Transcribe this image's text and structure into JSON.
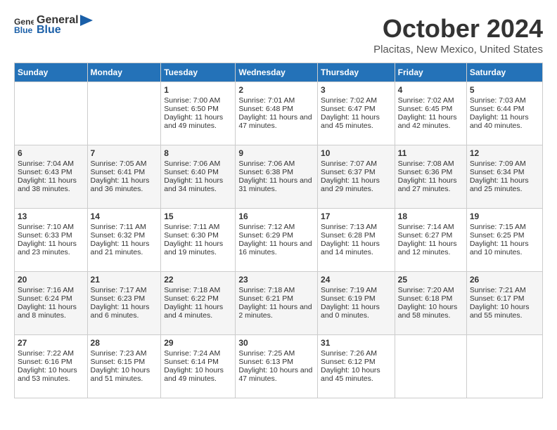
{
  "header": {
    "logo_line1": "General",
    "logo_line2": "Blue",
    "month_title": "October 2024",
    "location": "Placitas, New Mexico, United States"
  },
  "weekdays": [
    "Sunday",
    "Monday",
    "Tuesday",
    "Wednesday",
    "Thursday",
    "Friday",
    "Saturday"
  ],
  "weeks": [
    [
      {
        "day": "",
        "sunrise": "",
        "sunset": "",
        "daylight": ""
      },
      {
        "day": "",
        "sunrise": "",
        "sunset": "",
        "daylight": ""
      },
      {
        "day": "1",
        "sunrise": "Sunrise: 7:00 AM",
        "sunset": "Sunset: 6:50 PM",
        "daylight": "Daylight: 11 hours and 49 minutes."
      },
      {
        "day": "2",
        "sunrise": "Sunrise: 7:01 AM",
        "sunset": "Sunset: 6:48 PM",
        "daylight": "Daylight: 11 hours and 47 minutes."
      },
      {
        "day": "3",
        "sunrise": "Sunrise: 7:02 AM",
        "sunset": "Sunset: 6:47 PM",
        "daylight": "Daylight: 11 hours and 45 minutes."
      },
      {
        "day": "4",
        "sunrise": "Sunrise: 7:02 AM",
        "sunset": "Sunset: 6:45 PM",
        "daylight": "Daylight: 11 hours and 42 minutes."
      },
      {
        "day": "5",
        "sunrise": "Sunrise: 7:03 AM",
        "sunset": "Sunset: 6:44 PM",
        "daylight": "Daylight: 11 hours and 40 minutes."
      }
    ],
    [
      {
        "day": "6",
        "sunrise": "Sunrise: 7:04 AM",
        "sunset": "Sunset: 6:43 PM",
        "daylight": "Daylight: 11 hours and 38 minutes."
      },
      {
        "day": "7",
        "sunrise": "Sunrise: 7:05 AM",
        "sunset": "Sunset: 6:41 PM",
        "daylight": "Daylight: 11 hours and 36 minutes."
      },
      {
        "day": "8",
        "sunrise": "Sunrise: 7:06 AM",
        "sunset": "Sunset: 6:40 PM",
        "daylight": "Daylight: 11 hours and 34 minutes."
      },
      {
        "day": "9",
        "sunrise": "Sunrise: 7:06 AM",
        "sunset": "Sunset: 6:38 PM",
        "daylight": "Daylight: 11 hours and 31 minutes."
      },
      {
        "day": "10",
        "sunrise": "Sunrise: 7:07 AM",
        "sunset": "Sunset: 6:37 PM",
        "daylight": "Daylight: 11 hours and 29 minutes."
      },
      {
        "day": "11",
        "sunrise": "Sunrise: 7:08 AM",
        "sunset": "Sunset: 6:36 PM",
        "daylight": "Daylight: 11 hours and 27 minutes."
      },
      {
        "day": "12",
        "sunrise": "Sunrise: 7:09 AM",
        "sunset": "Sunset: 6:34 PM",
        "daylight": "Daylight: 11 hours and 25 minutes."
      }
    ],
    [
      {
        "day": "13",
        "sunrise": "Sunrise: 7:10 AM",
        "sunset": "Sunset: 6:33 PM",
        "daylight": "Daylight: 11 hours and 23 minutes."
      },
      {
        "day": "14",
        "sunrise": "Sunrise: 7:11 AM",
        "sunset": "Sunset: 6:32 PM",
        "daylight": "Daylight: 11 hours and 21 minutes."
      },
      {
        "day": "15",
        "sunrise": "Sunrise: 7:11 AM",
        "sunset": "Sunset: 6:30 PM",
        "daylight": "Daylight: 11 hours and 19 minutes."
      },
      {
        "day": "16",
        "sunrise": "Sunrise: 7:12 AM",
        "sunset": "Sunset: 6:29 PM",
        "daylight": "Daylight: 11 hours and 16 minutes."
      },
      {
        "day": "17",
        "sunrise": "Sunrise: 7:13 AM",
        "sunset": "Sunset: 6:28 PM",
        "daylight": "Daylight: 11 hours and 14 minutes."
      },
      {
        "day": "18",
        "sunrise": "Sunrise: 7:14 AM",
        "sunset": "Sunset: 6:27 PM",
        "daylight": "Daylight: 11 hours and 12 minutes."
      },
      {
        "day": "19",
        "sunrise": "Sunrise: 7:15 AM",
        "sunset": "Sunset: 6:25 PM",
        "daylight": "Daylight: 11 hours and 10 minutes."
      }
    ],
    [
      {
        "day": "20",
        "sunrise": "Sunrise: 7:16 AM",
        "sunset": "Sunset: 6:24 PM",
        "daylight": "Daylight: 11 hours and 8 minutes."
      },
      {
        "day": "21",
        "sunrise": "Sunrise: 7:17 AM",
        "sunset": "Sunset: 6:23 PM",
        "daylight": "Daylight: 11 hours and 6 minutes."
      },
      {
        "day": "22",
        "sunrise": "Sunrise: 7:18 AM",
        "sunset": "Sunset: 6:22 PM",
        "daylight": "Daylight: 11 hours and 4 minutes."
      },
      {
        "day": "23",
        "sunrise": "Sunrise: 7:18 AM",
        "sunset": "Sunset: 6:21 PM",
        "daylight": "Daylight: 11 hours and 2 minutes."
      },
      {
        "day": "24",
        "sunrise": "Sunrise: 7:19 AM",
        "sunset": "Sunset: 6:19 PM",
        "daylight": "Daylight: 11 hours and 0 minutes."
      },
      {
        "day": "25",
        "sunrise": "Sunrise: 7:20 AM",
        "sunset": "Sunset: 6:18 PM",
        "daylight": "Daylight: 10 hours and 58 minutes."
      },
      {
        "day": "26",
        "sunrise": "Sunrise: 7:21 AM",
        "sunset": "Sunset: 6:17 PM",
        "daylight": "Daylight: 10 hours and 55 minutes."
      }
    ],
    [
      {
        "day": "27",
        "sunrise": "Sunrise: 7:22 AM",
        "sunset": "Sunset: 6:16 PM",
        "daylight": "Daylight: 10 hours and 53 minutes."
      },
      {
        "day": "28",
        "sunrise": "Sunrise: 7:23 AM",
        "sunset": "Sunset: 6:15 PM",
        "daylight": "Daylight: 10 hours and 51 minutes."
      },
      {
        "day": "29",
        "sunrise": "Sunrise: 7:24 AM",
        "sunset": "Sunset: 6:14 PM",
        "daylight": "Daylight: 10 hours and 49 minutes."
      },
      {
        "day": "30",
        "sunrise": "Sunrise: 7:25 AM",
        "sunset": "Sunset: 6:13 PM",
        "daylight": "Daylight: 10 hours and 47 minutes."
      },
      {
        "day": "31",
        "sunrise": "Sunrise: 7:26 AM",
        "sunset": "Sunset: 6:12 PM",
        "daylight": "Daylight: 10 hours and 45 minutes."
      },
      {
        "day": "",
        "sunrise": "",
        "sunset": "",
        "daylight": ""
      },
      {
        "day": "",
        "sunrise": "",
        "sunset": "",
        "daylight": ""
      }
    ]
  ]
}
